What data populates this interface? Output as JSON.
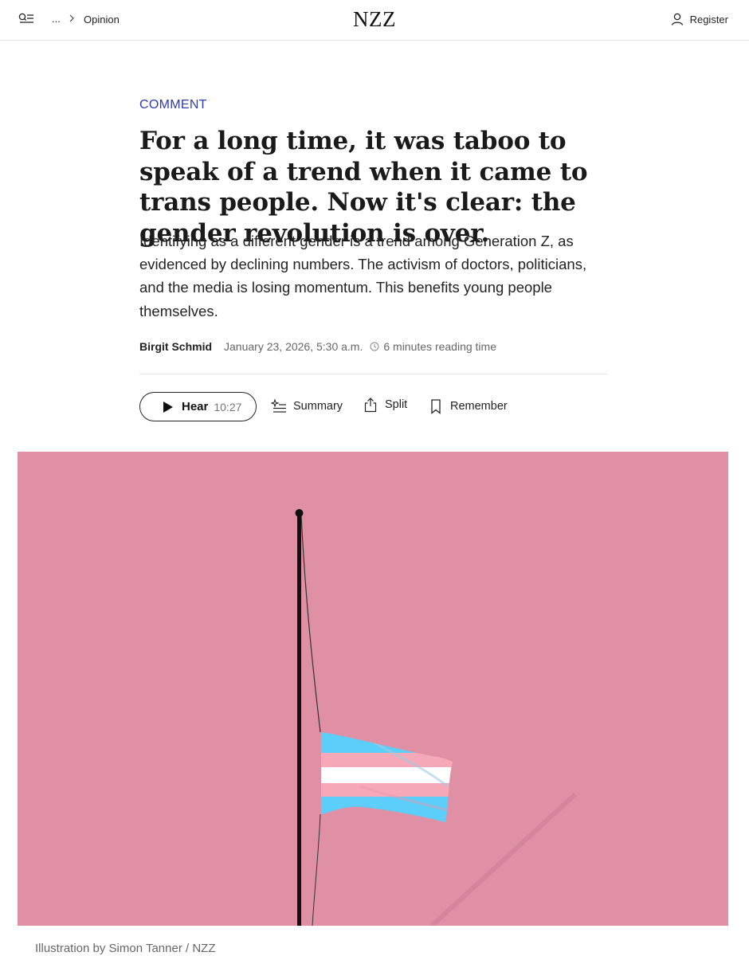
{
  "nav": {
    "breadcrumb_ellipsis": "...",
    "breadcrumb_section": "Opinion",
    "logo": "NZZ",
    "register_label": "Register"
  },
  "article": {
    "kicker": "COMMENT",
    "headline": "For a long time, it was taboo to speak of a trend when it came to trans people. Now it's clear: the gender revolution is over.",
    "lead": "Identifying as a different gender is a trend among Generation Z, as evidenced by declining numbers. The activism of doctors, politicians, and the media is losing momentum. This benefits young people themselves.",
    "author": "Birgit Schmid",
    "date": "January 23, 2026, 5:30 a.m.",
    "reading_time": "6 minutes reading time"
  },
  "actions": {
    "hear_label": "Hear",
    "hear_duration": "10:27",
    "summary_label": "Summary",
    "split_label": "Split",
    "remember_label": "Remember"
  },
  "image": {
    "caption": "Illustration by Simon Tanner / NZZ",
    "background_color": "#df90a5",
    "flag_colors": [
      "#5bcefa",
      "#f5a9b8",
      "#ffffff",
      "#f5a9b8",
      "#5bcefa"
    ]
  },
  "colors": {
    "kicker": "#2e3bab",
    "text": "#1a1a1a",
    "muted": "#666666"
  }
}
